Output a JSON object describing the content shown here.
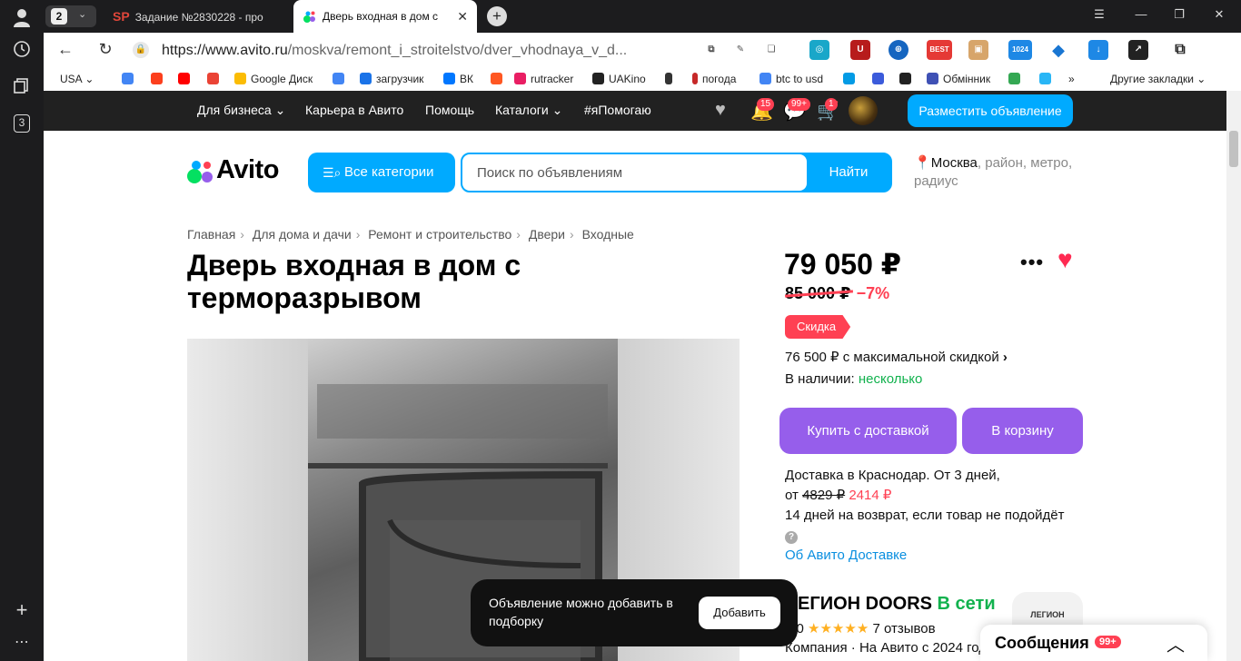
{
  "browser": {
    "tab_count": "2",
    "tabs": [
      {
        "title": "Задание №2830228 - про",
        "favicon": "SP"
      },
      {
        "title": "Дверь входная в дом с",
        "close": "✕"
      }
    ],
    "url_host": "https://www.avito.ru",
    "url_path": "/moskva/remont_i_stroitelstvo/dver_vhodnaya_v_d...",
    "sidebar_badge": "3",
    "bookmarks": [
      {
        "label": "USA",
        "color": "#ffffff"
      },
      {
        "label": "",
        "color": "#4285f4"
      },
      {
        "label": "",
        "color": "#fc3f1d"
      },
      {
        "label": "",
        "color": "#ff0000"
      },
      {
        "label": "",
        "color": "#ea4335"
      },
      {
        "label": "Google Диск",
        "color": "#fbbc04"
      },
      {
        "label": "",
        "color": "#4285f4"
      },
      {
        "label": "загрузчик",
        "color": "#1a73e8"
      },
      {
        "label": "ВК",
        "color": "#0077ff"
      },
      {
        "label": "",
        "color": "#ff5722"
      },
      {
        "label": "rutracker",
        "color": "#e91e63"
      },
      {
        "label": "UAKino",
        "color": "#222222"
      },
      {
        "label": "",
        "color": "#333333"
      },
      {
        "label": "погода",
        "color": "#c62828"
      },
      {
        "label": "btc to usd",
        "color": "#4285f4"
      },
      {
        "label": "",
        "color": "#039be5"
      },
      {
        "label": "",
        "color": "#3b5bdb"
      },
      {
        "label": "",
        "color": "#222222"
      },
      {
        "label": "Обмінник",
        "color": "#3f51b5"
      },
      {
        "label": "",
        "color": "#34a853"
      },
      {
        "label": "",
        "color": "#29b6f6"
      },
      {
        "label": "»",
        "color": "#ffffff"
      },
      {
        "label": "Другие закладки",
        "color": "#ffffff"
      }
    ]
  },
  "topnav": {
    "items": [
      "Для бизнеса",
      "Карьера в Авито",
      "Помощь",
      "Каталоги",
      "#яПомогаю"
    ],
    "notif_count": "15",
    "messages_count": "99+",
    "cart_count": "1",
    "post_button": "Разместить объявление"
  },
  "header": {
    "logo": "Avito",
    "categories_button": "Все категории",
    "search_placeholder": "Поиск по объявлениям",
    "search_button": "Найти",
    "location_city": "Москва",
    "location_rest": ", район, метро, радиус"
  },
  "breadcrumbs": [
    "Главная",
    "Для дома и дачи",
    "Ремонт и строительство",
    "Двери",
    "Входные"
  ],
  "listing": {
    "title": "Дверь входная в дом с терморазрывом",
    "price": "79 050 ₽",
    "old_price": "85 000 ₽",
    "discount_pct": "−7%",
    "sale_badge": "Скидка",
    "max_discount": "76 500 ₽ с максимальной скидкой",
    "stock_label": "В наличии:",
    "stock_value": "несколько",
    "buy_delivery": "Купить с доставкой",
    "to_cart": "В корзину",
    "delivery_line1": "Доставка в Краснодар. От 3 дней,",
    "delivery_from": "от",
    "delivery_old": "4829 ₽",
    "delivery_new": "2414 ₽",
    "return_policy": "14 дней на возврат, если товар не подойдёт",
    "about_delivery": "Об Авито Доставке"
  },
  "seller": {
    "name": "ЛЕГИОН DOORS",
    "online": "В сети",
    "rating": "5,0",
    "stars": "★★★★★",
    "reviews": "7 отзывов",
    "company": "Компания · На Авито с 2024 года",
    "logo_text": "ЛЕГИОН"
  },
  "toast": {
    "message": "Объявление можно добавить в подборку",
    "button": "Добавить"
  },
  "messages_widget": {
    "title": "Сообщения",
    "count": "99+"
  },
  "colors": {
    "avito_blue": "#00aaff",
    "buy_purple": "#965eeb",
    "discount_red": "#ff4053",
    "online_green": "#12b24e"
  }
}
